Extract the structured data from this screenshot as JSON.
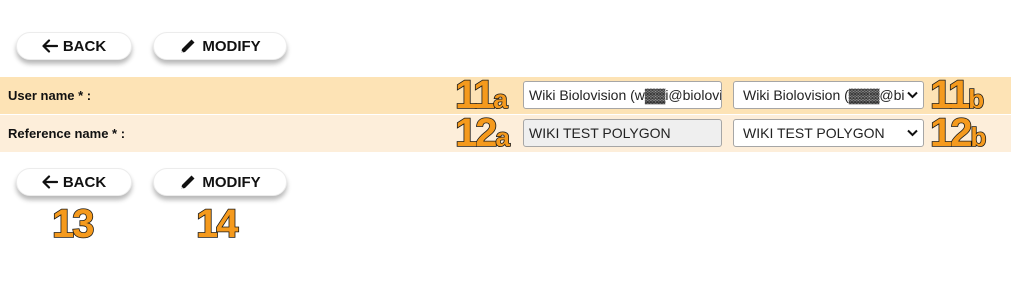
{
  "toolbar_top": {
    "back_label": "BACK",
    "modify_label": "MODIFY"
  },
  "form": {
    "rows": [
      {
        "label": "User name * :",
        "input_value": "Wiki Biolovision (w▓▓i@biolovis",
        "select_value": "Wiki Biolovision (▓▓▓@bi"
      },
      {
        "label": "Reference name * :",
        "input_value": "WIKI TEST POLYGON",
        "select_value": "WIKI TEST POLYGON"
      }
    ]
  },
  "toolbar_bottom": {
    "back_label": "BACK",
    "modify_label": "MODIFY"
  },
  "annotations": {
    "user_input": {
      "number": "11",
      "letter": "a"
    },
    "user_select": {
      "number": "11",
      "letter": "b"
    },
    "ref_input": {
      "number": "12",
      "letter": "a"
    },
    "ref_select": {
      "number": "12",
      "letter": "b"
    },
    "back_button": {
      "number": "13"
    },
    "modify_button": {
      "number": "14"
    }
  },
  "colors": {
    "row1_background": "#fde3b5",
    "row2_background": "#fdeeda",
    "annotation_fill": "#f59a1d",
    "annotation_stroke": "#1a1a1a"
  },
  "icons": {
    "back": "arrow-left-icon",
    "modify": "pencil-icon",
    "select": "chevron-down-icon"
  }
}
